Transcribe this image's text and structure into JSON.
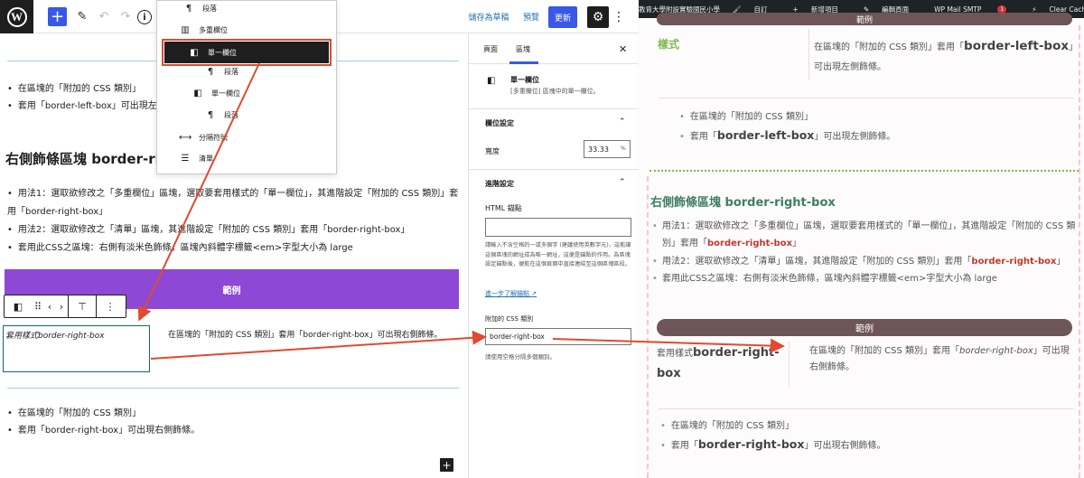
{
  "editor": {
    "toolbar": {
      "logo": "W",
      "add_icon": "+",
      "tools_icon": "✎",
      "undo_icon": "↶",
      "redo_icon": "↷",
      "info_icon": "i",
      "save_draft": "儲存為草稿",
      "preview": "預覽",
      "update": "更新",
      "settings_icon": "⚙",
      "more_icon": "⋮"
    },
    "list_view": [
      {
        "icon": "¶",
        "label": "段落"
      },
      {
        "icon": "▥",
        "label": "多重欄位"
      },
      {
        "icon": "◧",
        "label": "單一欄位"
      },
      {
        "icon": "¶",
        "label": "段落"
      },
      {
        "icon": "◧",
        "label": "單一欄位"
      },
      {
        "icon": "¶",
        "label": "段落"
      },
      {
        "icon": "⟷",
        "label": "分隔符號"
      },
      {
        "icon": "☰",
        "label": "清單"
      }
    ],
    "canvas": {
      "list1": [
        "在區塊的「附加的 CSS 類別」",
        "套用「border-left-box」可出現左"
      ],
      "heading": "右側飾條區塊 border-rig",
      "usage": [
        "用法1：選取欲修改之「多重欄位」區塊，選取要套用樣式的「單一欄位」，其進階設定「附加的 CSS 類別」套用「border-right-box」",
        "用法2：選取欲修改之「清單」區塊，其進階設定「附加的 CSS 類別」套用「border-right-box」",
        "套用此CSS之區塊：右側有淡米色飾條，區塊內斜體字標籤<em>字型大小為 large"
      ],
      "example_label": "範例",
      "block_toolbar": {
        "col_icon": "◧",
        "drag_icon": "⠿",
        "prev_icon": "‹",
        "next_icon": "›",
        "align_icon": "⊤",
        "more_icon": "⋮"
      },
      "col1_text": "套用樣式border-right-box",
      "col2_text": "在區塊的「附加的 CSS 類別」套用「border-right-box」可出現右側飾條。",
      "list2": [
        "在區塊的「附加的 CSS 類別」",
        "套用「border-right-box」可出現右側飾條。"
      ],
      "plus_icon": "+"
    },
    "sidebar": {
      "tab_page": "頁面",
      "tab_block": "區塊",
      "close_icon": "✕",
      "block_icon": "◧",
      "block_title": "單一欄位",
      "block_desc": "[多重欄位] 區塊中的單一欄位。",
      "column_settings": "欄位設定",
      "width_label": "寬度",
      "width_value": "33.33",
      "width_unit": "%",
      "advanced": "進階設定",
      "html_anchor_label": "HTML 錨點",
      "html_anchor_value": "",
      "html_anchor_help": "請輸入不含空格的一或多個字 (建議使用英數字元)，這能讓這個區塊的網址成為唯一網址，這便是錨點的作用。為區塊設定錨點後，便能在這個頁面中直接連結至這個區塊區段。",
      "learn_more": "進一步了解錨點",
      "css_label": "附加的 CSS 類別",
      "css_value": "border-right-box",
      "css_help": "請使用空格分隔多個類別。",
      "chevron": "⌃"
    }
  },
  "preview": {
    "adminbar": {
      "site": "教育大學附設實驗國民小學",
      "customize": "自訂",
      "new_item": "新增項目",
      "edit_page": "編輯頁面",
      "smtp": "WP Mail SMTP",
      "smtp_badge": "1",
      "clear_cache": "Clear Cache"
    },
    "top_pill": "範例",
    "style_label": "樣式",
    "style_text_pre": "在區塊的「附加的 CSS 類別」套用「",
    "style_text_bold": "border-left-box",
    "style_text_post": "」可出現左側飾條。",
    "left_list": [
      {
        "pre": "在區塊的「附加的 CSS 類別」",
        "bold": "",
        "post": ""
      },
      {
        "pre": "套用「",
        "bold": "border-left-box",
        "post": "」可出現左側飾條。"
      }
    ],
    "heading": "右側飾條區塊 border-right-box",
    "usage": [
      {
        "pre": "用法1：選取欲修改之「多重欄位」區塊，選取要套用樣式的「單一欄位」，其進階設定「附加的 CSS 類別」套用「",
        "red": "border-right-box",
        "post": "」"
      },
      {
        "pre": "用法2：選取欲修改之「清單」區塊，其進階設定「附加的 CSS 類別」套用「",
        "red": "border-right-box",
        "post": "」"
      },
      {
        "pre": "套用此CSS之區塊：右側有淡米色飾條，區塊內斜體字標籤<em>字型大小為 large",
        "red": "",
        "post": ""
      }
    ],
    "example_label": "範例",
    "col1_pre": "套用樣式",
    "col1_bold": "border-right-box",
    "col2_pre": "在區塊的「附加的 CSS 類別」套用「",
    "col2_em": "border-right-box",
    "col2_post": "」可出現右側飾條。",
    "right_list": [
      {
        "pre": "在區塊的「附加的 CSS 類別」",
        "bold": "",
        "post": ""
      },
      {
        "pre": "套用「",
        "bold": "border-right-box",
        "post": "」可出現右側飾條。"
      }
    ]
  },
  "colors": {
    "accent_blue": "#3858e9",
    "purple_block": "#8e48d6",
    "annotation_red": "#e04a2f",
    "preview_pill": "#6e5558",
    "preview_heading": "#3d8060",
    "style_label_green": "#7fbb4e"
  }
}
